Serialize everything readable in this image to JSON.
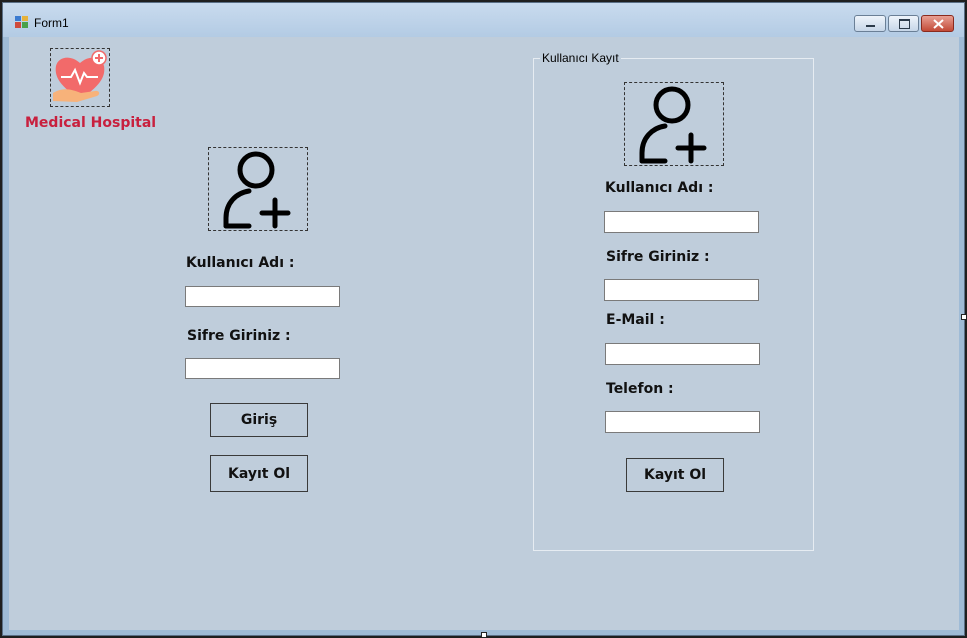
{
  "window": {
    "title": "Form1"
  },
  "brand": {
    "name": "Medical Hospital"
  },
  "login": {
    "username_label": "Kullanıcı Adı :",
    "username_value": "",
    "password_label": "Sifre Giriniz :",
    "password_value": "",
    "login_button": "Giriş",
    "register_button": "Kayıt Ol"
  },
  "register": {
    "group_title": "Kullanıcı Kayıt",
    "username_label": "Kullanıcı Adı :",
    "username_value": "",
    "password_label": "Sifre Giriniz :",
    "password_value": "",
    "email_label": "E-Mail :",
    "email_value": "",
    "phone_label": "Telefon :",
    "phone_value": "",
    "register_button": "Kayıt Ol"
  },
  "icons": {
    "app": "app-icon",
    "logo": "heart-care-icon",
    "user_add": "user-add-icon"
  },
  "colors": {
    "brand": "#c8203e",
    "client_bg": "#bfcddb"
  }
}
